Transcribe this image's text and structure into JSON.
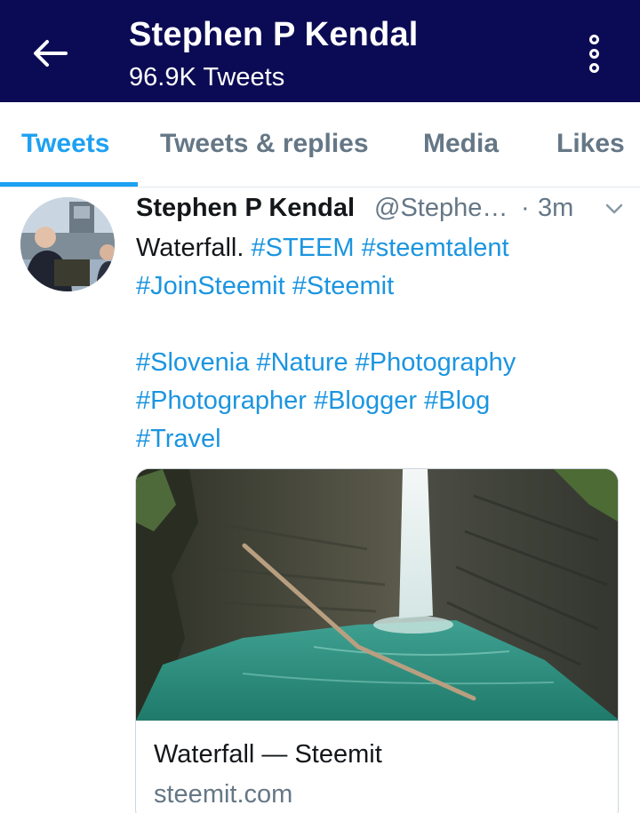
{
  "header": {
    "title": "Stephen P Kendal",
    "subtitle": "96.9K Tweets",
    "background_color": "#0b0b55",
    "back_icon": "arrow-left-icon",
    "more_icon": "more-vertical-icon"
  },
  "tabs": [
    {
      "label": "Tweets",
      "active": true
    },
    {
      "label": "Tweets & replies",
      "active": false
    },
    {
      "label": "Media",
      "active": false
    },
    {
      "label": "Likes",
      "active": false
    }
  ],
  "accent_color": "#1da1f2",
  "tweet": {
    "author_name": "Stephen P Kendal",
    "author_handle": "@Stephe…",
    "separator": "·",
    "time": "3m",
    "text_plain": "Waterfall.",
    "hashtags_line1": [
      "#STEEM",
      "#steemtalent"
    ],
    "hashtags_line2": [
      "#JoinSteemit",
      "#Steemit"
    ],
    "hashtags_line3": [
      "#Slovenia",
      "#Nature",
      "#Photography"
    ],
    "hashtags_line4": [
      "#Photographer",
      "#Blogger",
      "#Blog"
    ],
    "hashtags_line5": [
      "#Travel"
    ],
    "card": {
      "title": "Waterfall — Steemit",
      "domain": "steemit.com"
    }
  }
}
